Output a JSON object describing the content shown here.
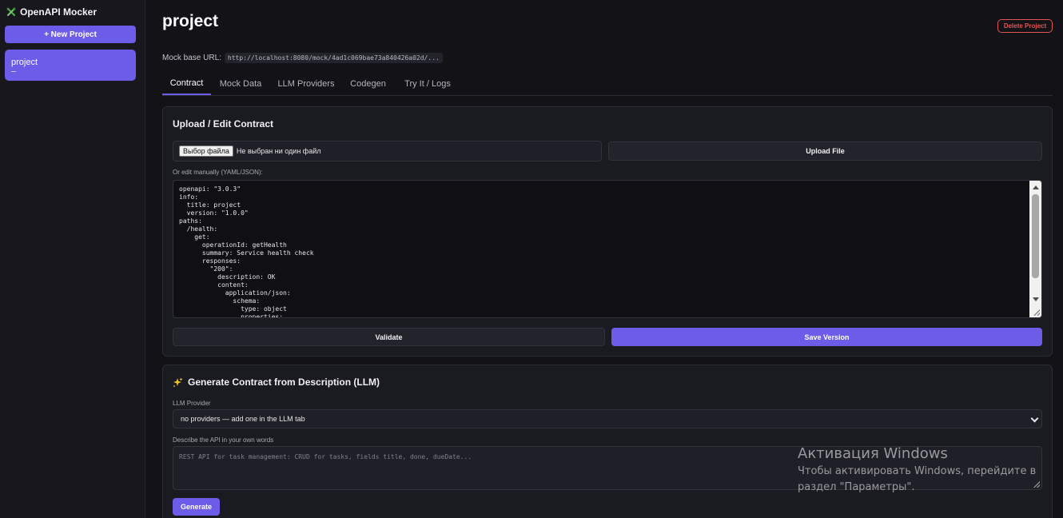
{
  "sidebar": {
    "brand": "OpenAPI Mocker",
    "new_project_label": "+ New Project",
    "projects": [
      {
        "name": "project",
        "meta": "—"
      }
    ]
  },
  "header": {
    "title": "project",
    "delete_label": "Delete Project",
    "base_url_label": "Mock base URL:",
    "base_url_value": "http://localhost:8080/mock/4ad1c069bae73a840426a02d/..."
  },
  "tabs": [
    {
      "label": "Contract",
      "active": true
    },
    {
      "label": "Mock Data",
      "active": false
    },
    {
      "label": "LLM Providers",
      "active": false
    },
    {
      "label": "Codegen",
      "active": false
    },
    {
      "label": "Try It / Logs",
      "active": false
    }
  ],
  "contract": {
    "title": "Upload / Edit Contract",
    "file_button": "Выбор файла",
    "file_status": "Не выбран ни один файл",
    "upload_label": "Upload File",
    "manual_label": "Or edit manually (YAML/JSON):",
    "content": "openapi: \"3.0.3\"\ninfo:\n  title: project\n  version: \"1.0.0\"\npaths:\n  /health:\n    get:\n      operationId: getHealth\n      summary: Service health check\n      responses:\n        \"200\":\n          description: OK\n          content:\n            application/json:\n              schema:\n                type: object\n                properties:",
    "validate_label": "Validate",
    "save_label": "Save Version"
  },
  "generate": {
    "icon": "sparkles-icon",
    "title": "Generate Contract from Description (LLM)",
    "provider_label": "LLM Provider",
    "provider_value": "no providers — add one in the LLM tab",
    "description_label": "Describe the API in your own words",
    "description_placeholder": "REST API for task management: CRUD for tasks, fields title, done, dueDate...",
    "generate_label": "Generate"
  },
  "watermark": {
    "line1": "Активация Windows",
    "line2": "Чтобы активировать Windows, перейдите в раздел \"Параметры\"."
  },
  "colors": {
    "accent": "#6c5ce7",
    "danger": "#e05555",
    "background": "#121217",
    "card": "#1a1a21"
  }
}
